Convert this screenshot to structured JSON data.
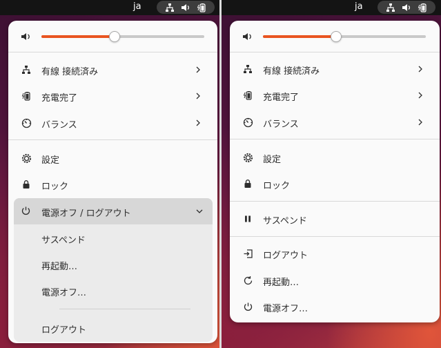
{
  "topbar": {
    "lang": "ja"
  },
  "left": {
    "volume": {
      "level": 0.45
    },
    "items": [
      {
        "label": "有線 接続済み",
        "icon": "network-wired-icon"
      },
      {
        "label": "充電完了",
        "icon": "battery-full-charged-icon"
      },
      {
        "label": "バランス",
        "icon": "power-profile-icon"
      },
      {
        "label": "設定",
        "icon": "gear-icon"
      },
      {
        "label": "ロック",
        "icon": "lock-icon"
      }
    ],
    "power_menu": {
      "header": "電源オフ / ログアウト",
      "items": [
        "サスペンド",
        "再起動…",
        "電源オフ…",
        "ログアウト"
      ]
    }
  },
  "right": {
    "volume": {
      "level": 0.45
    },
    "items": [
      {
        "label": "有線 接続済み",
        "icon": "network-wired-icon"
      },
      {
        "label": "充電完了",
        "icon": "battery-full-charged-icon"
      },
      {
        "label": "バランス",
        "icon": "power-profile-icon"
      },
      {
        "label": "設定",
        "icon": "gear-icon"
      },
      {
        "label": "ロック",
        "icon": "lock-icon"
      },
      {
        "label": "サスペンド",
        "icon": "pause-icon"
      },
      {
        "label": "ログアウト",
        "icon": "logout-icon"
      },
      {
        "label": "再起動…",
        "icon": "restart-icon"
      },
      {
        "label": "電源オフ…",
        "icon": "power-icon"
      }
    ]
  },
  "colors": {
    "accent": "#e95420",
    "menu_bg": "#fafafa",
    "topbar": "#141414"
  }
}
